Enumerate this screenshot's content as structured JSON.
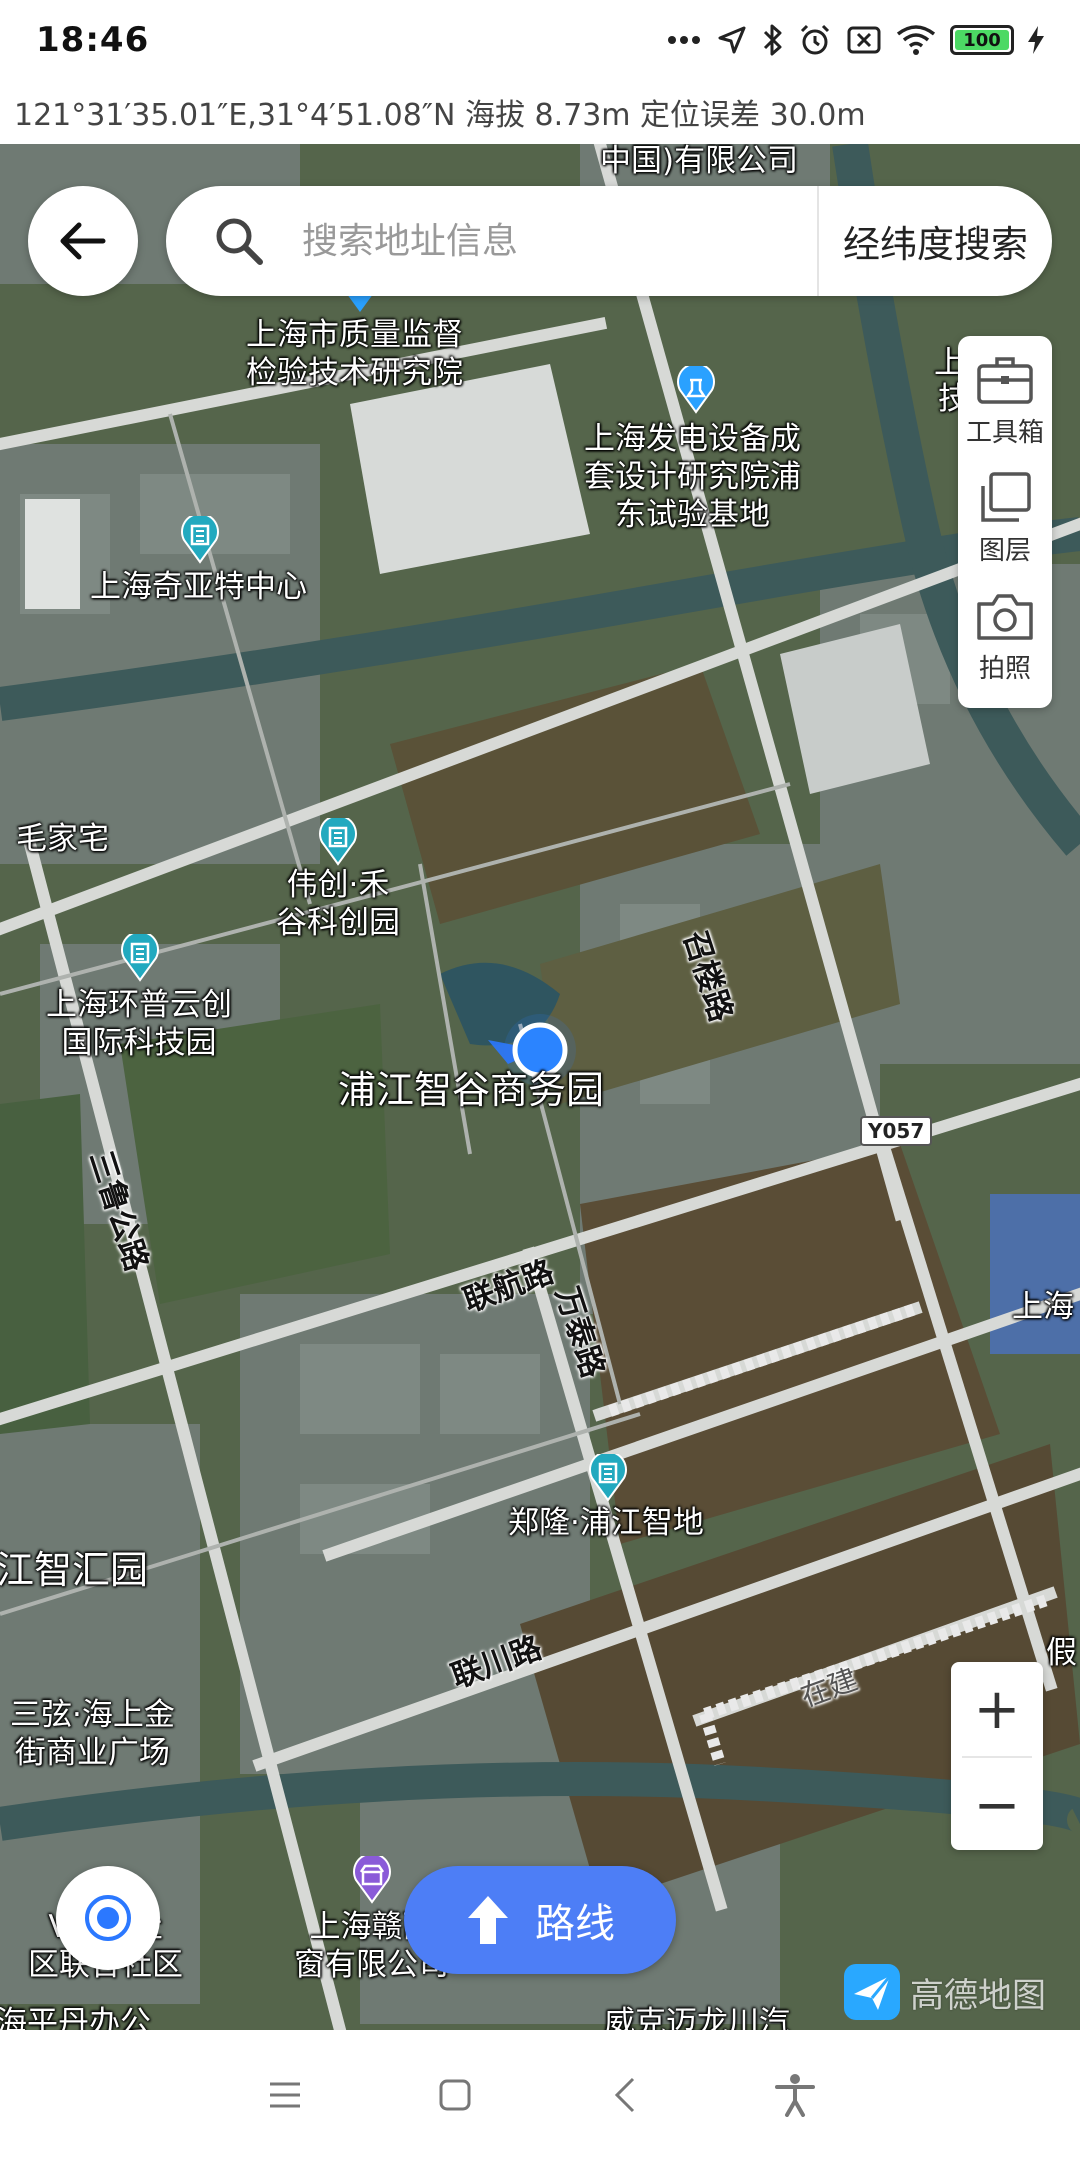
{
  "status_bar": {
    "time": "18:46",
    "battery": "100",
    "battery_level": 1.0
  },
  "coord_bar": {
    "text": "121°31′35.01″E,31°4′51.08″N  海拔 8.73m  定位误差 30.0m"
  },
  "search": {
    "placeholder": "搜索地址信息",
    "latlng_button": "经纬度搜索"
  },
  "tools": [
    {
      "label": "工具箱",
      "icon": "toolbox-icon"
    },
    {
      "label": "图层",
      "icon": "layers-icon"
    },
    {
      "label": "拍照",
      "icon": "camera-icon"
    }
  ],
  "zoom": {
    "in": "+",
    "out": "−"
  },
  "route": {
    "label": "路线"
  },
  "logo": {
    "label": "高德地图"
  },
  "map": {
    "pois": [
      {
        "name": "中国)有限公司"
      },
      {
        "name": "上海市质量监督\n检验技术研究院"
      },
      {
        "name": "上海发电设备成\n套设计研究院浦\n东试验基地"
      },
      {
        "name": "上海奇亚特中心"
      },
      {
        "name": "上海环普云创\n国际科技园"
      },
      {
        "name": "伟创·禾\n谷科创园"
      },
      {
        "name": "毛家宅"
      },
      {
        "name": "浦江智谷商务园"
      },
      {
        "name": "郑隆·浦江智地"
      },
      {
        "name": "江智汇园"
      },
      {
        "name": "三弦·海上金\n街商业广场"
      },
      {
        "name": "上海赣丽\n窗有限公司"
      },
      {
        "name": "V智非社\n区联合社区"
      },
      {
        "name": "上海抚"
      },
      {
        "name": "上海"
      },
      {
        "name": "技"
      },
      {
        "name": "假"
      },
      {
        "name": "海平丹办公"
      },
      {
        "name": "威克迈龙川汽"
      }
    ],
    "roads": [
      {
        "name": "召楼路"
      },
      {
        "name": "三鲁公路"
      },
      {
        "name": "联航路"
      },
      {
        "name": "万泰路"
      },
      {
        "name": "联川路"
      },
      {
        "name": "在建"
      }
    ],
    "road_tag": "Y057"
  }
}
